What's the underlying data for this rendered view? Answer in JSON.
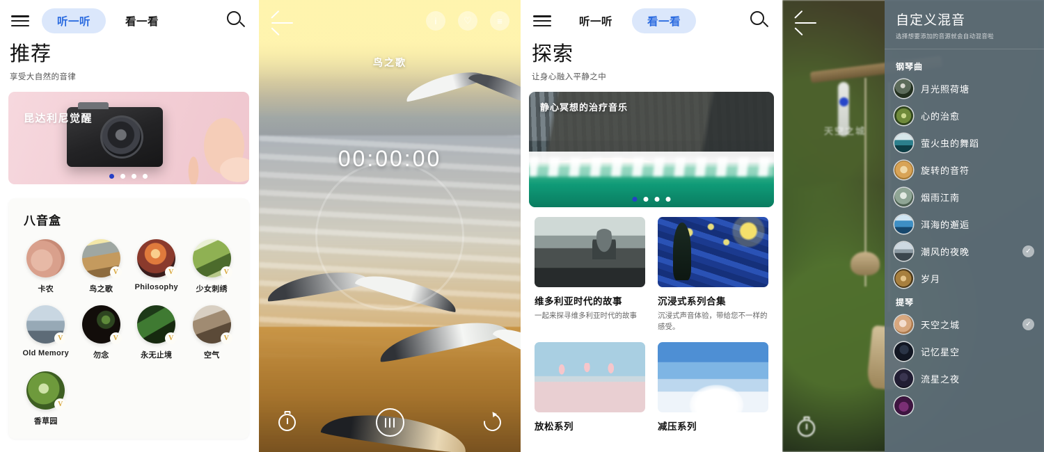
{
  "panel1": {
    "name": "recommend-screen",
    "topbar": {
      "menu_icon": "hamburger-icon",
      "tabs": [
        {
          "label": "听一听",
          "active": true
        },
        {
          "label": "看一看",
          "active": false
        }
      ],
      "search_icon": "search-icon"
    },
    "heading": {
      "title": "推荐",
      "subtitle": "享受大自然的音律"
    },
    "banner": {
      "title": "昆达利尼觉醒",
      "dots": 4,
      "active_dot": 0
    },
    "section": {
      "title": "八音盒",
      "items": [
        {
          "name": "卡农",
          "badge": "",
          "art": "t-feet"
        },
        {
          "name": "鸟之歌",
          "badge": "V",
          "art": "t-bird"
        },
        {
          "name": "Philosophy",
          "badge": "V",
          "art": "t-philo"
        },
        {
          "name": "少女刺绣",
          "badge": "V",
          "art": "t-emb"
        },
        {
          "name": "Old Memory",
          "badge": "V",
          "art": "t-old"
        },
        {
          "name": "勿念",
          "badge": "V",
          "art": "t-wu"
        },
        {
          "name": "永无止境",
          "badge": "V",
          "art": "t-yong"
        },
        {
          "name": "空气",
          "badge": "V",
          "art": "t-air"
        },
        {
          "name": "香草园",
          "badge": "V",
          "art": "t-herb"
        }
      ]
    }
  },
  "panel2": {
    "name": "player-screen",
    "back_icon": "back-arrow-icon",
    "top_icons": [
      "info-icon",
      "heart-icon",
      "list-icon"
    ],
    "song_title": "鸟之歌",
    "timecode": "00:00:00",
    "controls": {
      "timer_icon": "timer-icon",
      "pause_icon": "pause-icon",
      "loop_icon": "loop-icon"
    }
  },
  "panel3": {
    "name": "explore-screen",
    "topbar": {
      "menu_icon": "hamburger-icon",
      "tabs": [
        {
          "label": "听一听",
          "active": false
        },
        {
          "label": "看一看",
          "active": true
        }
      ],
      "search_icon": "search-icon"
    },
    "heading": {
      "title": "探索",
      "subtitle": "让身心融入平静之中"
    },
    "banner": {
      "title": "静心冥想的治疗音乐",
      "dots": 4,
      "active_dot": 0
    },
    "cards": [
      {
        "title": "维多利亚时代的故事",
        "desc": "一起来探寻维多利亚时代的故事",
        "art": "ct-vic"
      },
      {
        "title": "沉浸式系列合集",
        "desc": "沉浸式声音体验，带给您不一样的感受。",
        "art": "ct-star"
      },
      {
        "title": "放松系列",
        "desc": "",
        "art": "ct-flam"
      },
      {
        "title": "减压系列",
        "desc": "",
        "art": "ct-cloud"
      }
    ]
  },
  "panel4": {
    "name": "custom-mix-screen",
    "back_icon": "back-arrow-icon",
    "bg_label": "天空之城",
    "timer_icon": "timer-icon",
    "title": "自定义混音",
    "subtitle": "选择想要添加的音源就会自动混音啦",
    "groups": [
      {
        "label": "钢琴曲",
        "items": [
          {
            "name": "月光照荷塘",
            "selected": false,
            "art": "m-moon"
          },
          {
            "name": "心的治愈",
            "selected": false,
            "art": "m-heal"
          },
          {
            "name": "萤火虫的舞蹈",
            "selected": false,
            "art": "m-fire"
          },
          {
            "name": "旋转的音符",
            "selected": false,
            "art": "m-note"
          },
          {
            "name": "烟雨江南",
            "selected": false,
            "art": "m-yan"
          },
          {
            "name": "洱海的邂逅",
            "selected": false,
            "art": "m-erhai"
          },
          {
            "name": "潮风的夜晚",
            "selected": true,
            "art": "m-chao"
          },
          {
            "name": "岁月",
            "selected": false,
            "art": "m-sui"
          }
        ]
      },
      {
        "label": "提琴",
        "items": [
          {
            "name": "天空之城",
            "selected": true,
            "art": "m-sky"
          },
          {
            "name": "记忆星空",
            "selected": false,
            "art": "m-mem"
          },
          {
            "name": "流星之夜",
            "selected": false,
            "art": "m-met"
          },
          {
            "name": "",
            "selected": false,
            "art": "m-last"
          }
        ]
      }
    ],
    "check_glyph": "✓"
  },
  "colors": {
    "accent_blue": "#2c6ce0",
    "pill_bg": "#dbe7fb",
    "dot_active": "#2540c6",
    "mix_panel": "#5e6e78",
    "badge_gold": "#d8a63c"
  }
}
